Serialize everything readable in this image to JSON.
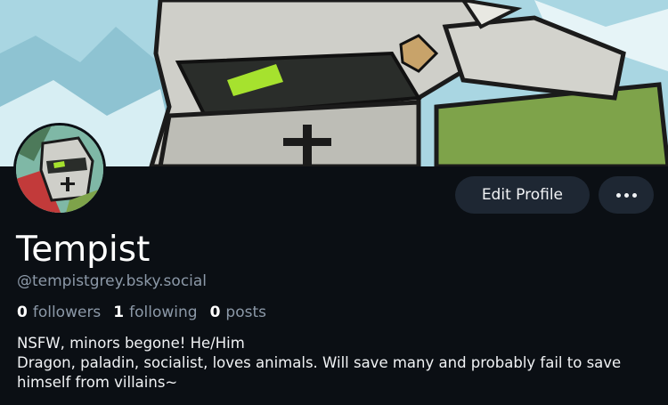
{
  "profile": {
    "display_name": "Tempist",
    "handle": "@tempistgrey.bsky.social",
    "stats": [
      {
        "count": "0",
        "label": "followers"
      },
      {
        "count": "1",
        "label": "following"
      },
      {
        "count": "0",
        "label": "posts"
      }
    ],
    "bio_lines": [
      "NSFW, minors begone! He/Him",
      "Dragon, paladin, socialist, loves animals. Will save many and probably fail to save",
      "himself from villains~"
    ]
  },
  "actions": {
    "edit_profile_label": "Edit Profile",
    "more_icon": "more-dots-icon"
  },
  "colors": {
    "background": "#0b0f14",
    "button_bg": "#1e2733",
    "muted_text": "#8c99a8",
    "banner_sky": "#a8d8e4",
    "armor": "#c9c9c3",
    "visor_glow": "#a6e22e",
    "dragon_green": "#7ea34a"
  }
}
